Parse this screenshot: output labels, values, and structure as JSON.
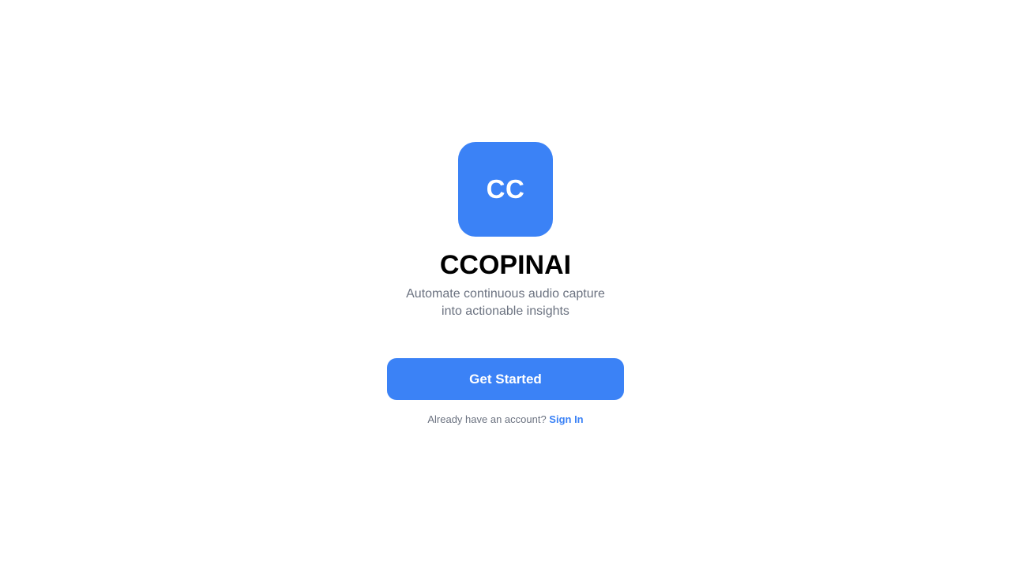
{
  "logo": {
    "initials": "CC",
    "color": "#3b82f6"
  },
  "app": {
    "title": "CCOPINAI",
    "tagline": "Automate continuous audio capture into actionable insights"
  },
  "actions": {
    "get_started_label": "Get Started",
    "account_prompt": "Already have an account?",
    "sign_in_label": "Sign In"
  },
  "theme": {
    "accent": "#3b82f6",
    "muted_text": "#6b7280",
    "background": "#ffffff"
  }
}
